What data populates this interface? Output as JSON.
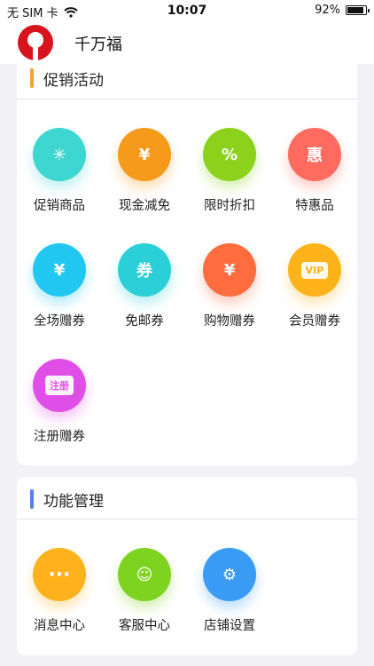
{
  "status_bar": {
    "carrier": "无 SIM 卡",
    "time": "10:07",
    "battery": "92%"
  },
  "header": {
    "title": "千万福"
  },
  "sections": [
    {
      "title": "促销活动",
      "accent": "#f2a23a",
      "items": [
        {
          "label": "促销商品",
          "icon": "price-tag-icon",
          "color": "#3dd6d0",
          "glyph": "✳"
        },
        {
          "label": "现金减免",
          "icon": "yen-coin-icon",
          "color": "#f59a1b",
          "glyph": "¥"
        },
        {
          "label": "限时折扣",
          "icon": "percent-badge-icon",
          "color": "#8cd21d",
          "glyph": "%"
        },
        {
          "label": "特惠品",
          "icon": "special-offer-icon",
          "color": "#ff6b5e",
          "glyph": "惠"
        },
        {
          "label": "全场赠券",
          "icon": "receipt-yen-icon",
          "color": "#21c7f1",
          "glyph": "¥"
        },
        {
          "label": "免邮券",
          "icon": "free-shipping-coupon-icon",
          "color": "#2bcfd7",
          "glyph": "券"
        },
        {
          "label": "购物赠券",
          "icon": "shopping-coupon-icon",
          "color": "#ff6c3e",
          "glyph": "¥"
        },
        {
          "label": "会员赠券",
          "icon": "vip-ticket-icon",
          "color": "#ffb31a",
          "glyph": "VIP"
        },
        {
          "label": "注册赠券",
          "icon": "register-coupon-icon",
          "color": "#e04ee8",
          "glyph": "注册"
        }
      ]
    },
    {
      "title": "功能管理",
      "accent": "#5b7cf0",
      "items": [
        {
          "label": "消息中心",
          "icon": "message-bubble-icon",
          "color": "#ffb21d",
          "glyph": "···"
        },
        {
          "label": "客服中心",
          "icon": "customer-service-icon",
          "color": "#7ed321",
          "glyph": "☺"
        },
        {
          "label": "店铺设置",
          "icon": "store-settings-icon",
          "color": "#3a9bf5",
          "glyph": "⚙"
        }
      ]
    }
  ]
}
